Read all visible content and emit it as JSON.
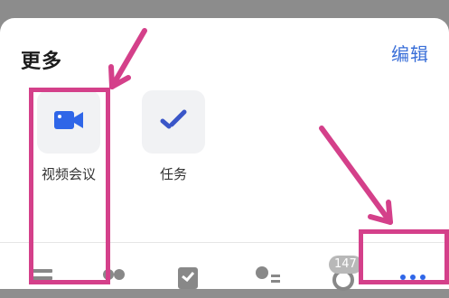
{
  "sheet": {
    "title": "更多",
    "edit_label": "编辑"
  },
  "apps": [
    {
      "label": "视频会议",
      "icon": "video-camera-icon",
      "color": "#2f66e8"
    },
    {
      "label": "任务",
      "icon": "task-check-icon",
      "color": "#3a56c8"
    }
  ],
  "tabbar": {
    "items": [
      {
        "icon": "messages-icon"
      },
      {
        "icon": "contacts-icon"
      },
      {
        "icon": "documents-icon"
      },
      {
        "icon": "user-list-icon"
      },
      {
        "icon": "workspace-icon",
        "badge": "147"
      },
      {
        "icon": "more-dots-icon"
      }
    ]
  },
  "annotations": {
    "color": "#d4408a"
  }
}
